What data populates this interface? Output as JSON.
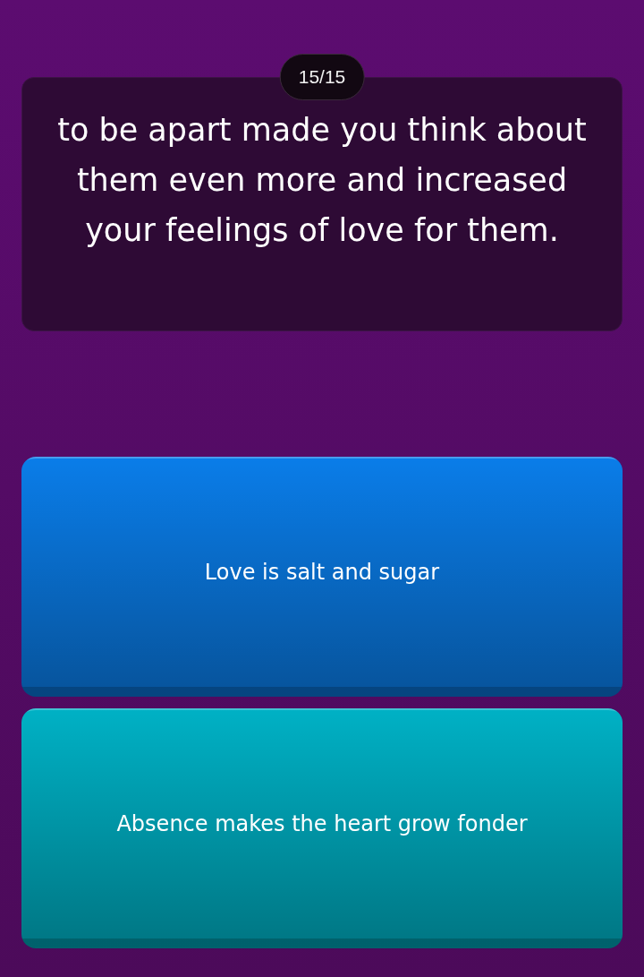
{
  "question": {
    "counter": "15/15",
    "text": "to be apart made you think about them even more and increased your feelings of love for them."
  },
  "options": [
    {
      "label": "Love is salt and sugar",
      "color": "#0a7de9"
    },
    {
      "label": "Absence makes the heart grow fonder",
      "color": "#00b1c5"
    }
  ]
}
